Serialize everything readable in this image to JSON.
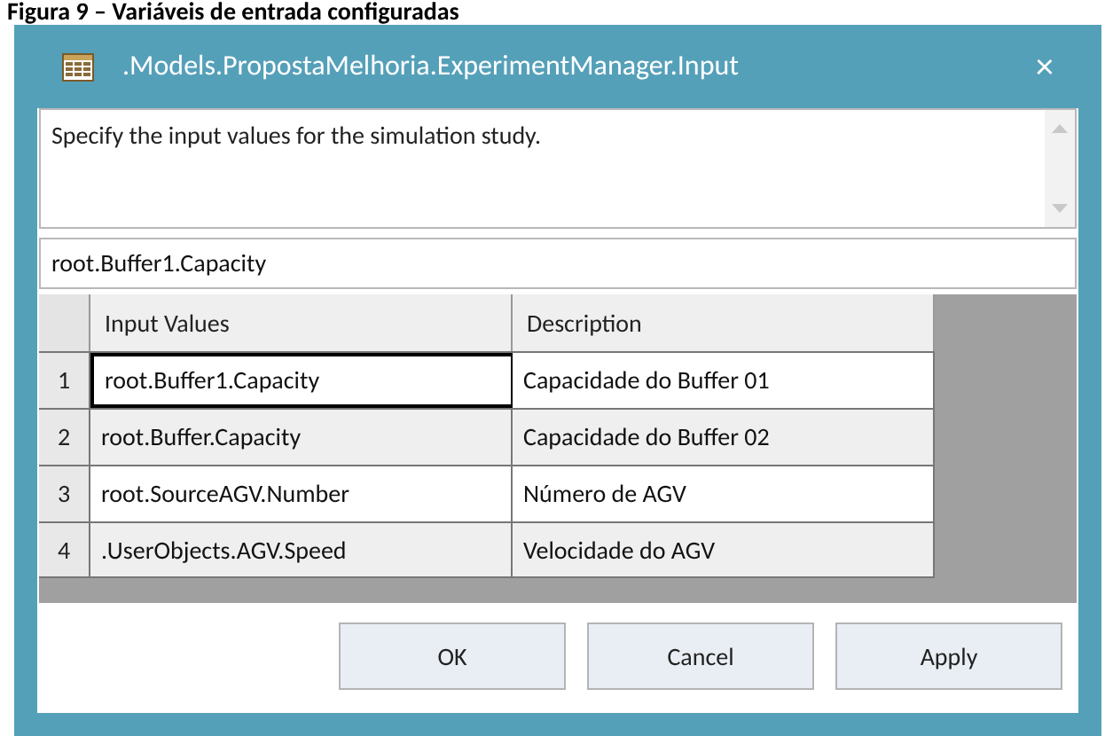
{
  "caption": "Figura 9 – Variáveis de entrada configuradas",
  "window": {
    "title": ".Models.PropostaMelhoria.ExperimentManager.Input",
    "close": "×"
  },
  "description": "Specify the input values for the simulation study.",
  "current_value": "root.Buffer1.Capacity",
  "table": {
    "columns": [
      "Input Values",
      "Description"
    ],
    "rows": [
      {
        "number": "1",
        "input": "root.Buffer1.Capacity",
        "description": "Capacidade do Buffer 01",
        "selected": true
      },
      {
        "number": "2",
        "input": "root.Buffer.Capacity",
        "description": "Capacidade do Buffer 02",
        "selected": false
      },
      {
        "number": "3",
        "input": "root.SourceAGV.Number",
        "description": "Número de AGV",
        "selected": false
      },
      {
        "number": "4",
        "input": ".UserObjects.AGV.Speed",
        "description": "Velocidade do AGV",
        "selected": false
      }
    ]
  },
  "buttons": [
    "OK",
    "Cancel",
    "Apply"
  ]
}
